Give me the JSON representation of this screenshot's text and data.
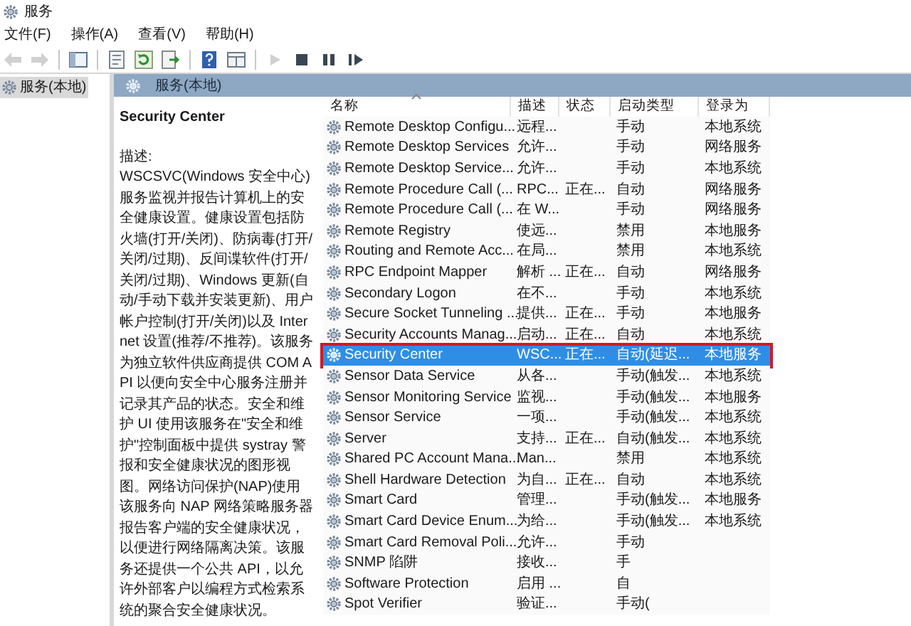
{
  "window": {
    "title": "服务"
  },
  "menu": [
    {
      "label": "文件(F)"
    },
    {
      "label": "操作(A)"
    },
    {
      "label": "查看(V)"
    },
    {
      "label": "帮助(H)"
    }
  ],
  "toolbar": [
    {
      "kind": "back",
      "disabled": true
    },
    {
      "kind": "forward",
      "disabled": true
    },
    {
      "kind": "sep"
    },
    {
      "kind": "tree",
      "disabled": false
    },
    {
      "kind": "sep"
    },
    {
      "kind": "properties",
      "disabled": false
    },
    {
      "kind": "refresh",
      "disabled": false
    },
    {
      "kind": "export",
      "disabled": false
    },
    {
      "kind": "sep"
    },
    {
      "kind": "help",
      "disabled": false
    },
    {
      "kind": "view",
      "disabled": false
    },
    {
      "kind": "sep"
    },
    {
      "kind": "play",
      "disabled": true
    },
    {
      "kind": "stop",
      "disabled": false
    },
    {
      "kind": "pause",
      "disabled": false
    },
    {
      "kind": "resume",
      "disabled": false
    }
  ],
  "tree": {
    "items": [
      {
        "label": "服务(本地)",
        "selected": true
      }
    ]
  },
  "pane_header": "服务(本地)",
  "details": {
    "title": "Security Center",
    "label": "描述:",
    "text": "WSCSVC(Windows 安全中心)服务监视并报告计算机上的安全健康设置。健康设置包括防火墙(打开/关闭)、防病毒(打开/关闭/过期)、反间谍软件(打开/关闭/过期)、Windows 更新(自动/手动下载并安装更新)、用户帐户控制(打开/关闭)以及 Internet 设置(推荐/不推荐)。该服务为独立软件供应商提供 COM API 以便向安全中心服务注册并记录其产品的状态。安全和维护 UI 使用该服务在\"安全和维护\"控制面板中提供 systray 警报和安全健康状况的图形视图。网络访问保护(NAP)使用该服务向 NAP 网络策略服务器报告客户端的安全健康状况，以便进行网络隔离决策。该服务还提供一个公共 API，以允许外部客户以编程方式检索系统的聚合安全健康状况。"
  },
  "table": {
    "columns": [
      "名称",
      "描述",
      "状态",
      "启动类型",
      "登录为"
    ],
    "rows": [
      {
        "name": "Remote Desktop Configu...",
        "desc": "远程...",
        "status": "",
        "startup": "手动",
        "logon": "本地系统",
        "selected": false
      },
      {
        "name": "Remote Desktop Services",
        "desc": "允许...",
        "status": "",
        "startup": "手动",
        "logon": "网络服务",
        "selected": false
      },
      {
        "name": "Remote Desktop Service...",
        "desc": "允许...",
        "status": "",
        "startup": "手动",
        "logon": "本地系统",
        "selected": false
      },
      {
        "name": "Remote Procedure Call (...",
        "desc": "RPC...",
        "status": "正在...",
        "startup": "自动",
        "logon": "网络服务",
        "selected": false
      },
      {
        "name": "Remote Procedure Call (...",
        "desc": "在 W...",
        "status": "",
        "startup": "手动",
        "logon": "网络服务",
        "selected": false
      },
      {
        "name": "Remote Registry",
        "desc": "使远...",
        "status": "",
        "startup": "禁用",
        "logon": "本地服务",
        "selected": false
      },
      {
        "name": "Routing and Remote Acc...",
        "desc": "在局...",
        "status": "",
        "startup": "禁用",
        "logon": "本地系统",
        "selected": false
      },
      {
        "name": "RPC Endpoint Mapper",
        "desc": "解析 ...",
        "status": "正在...",
        "startup": "自动",
        "logon": "网络服务",
        "selected": false
      },
      {
        "name": "Secondary Logon",
        "desc": "在不...",
        "status": "",
        "startup": "手动",
        "logon": "本地系统",
        "selected": false
      },
      {
        "name": "Secure Socket Tunneling ...",
        "desc": "提供...",
        "status": "正在...",
        "startup": "手动",
        "logon": "本地服务",
        "selected": false
      },
      {
        "name": "Security Accounts Manag...",
        "desc": "启动...",
        "status": "正在...",
        "startup": "自动",
        "logon": "本地系统",
        "selected": false
      },
      {
        "name": "Security Center",
        "desc": "WSC...",
        "status": "正在...",
        "startup": "自动(延迟...",
        "logon": "本地服务",
        "selected": true
      },
      {
        "name": "Sensor Data Service",
        "desc": "从各...",
        "status": "",
        "startup": "手动(触发...",
        "logon": "本地系统",
        "selected": false
      },
      {
        "name": "Sensor Monitoring Service",
        "desc": "监视...",
        "status": "",
        "startup": "手动(触发...",
        "logon": "本地服务",
        "selected": false
      },
      {
        "name": "Sensor Service",
        "desc": "一项...",
        "status": "",
        "startup": "手动(触发...",
        "logon": "本地系统",
        "selected": false
      },
      {
        "name": "Server",
        "desc": "支持...",
        "status": "正在...",
        "startup": "自动(触发...",
        "logon": "本地系统",
        "selected": false
      },
      {
        "name": "Shared PC Account Mana...",
        "desc": "Man...",
        "status": "",
        "startup": "禁用",
        "logon": "本地系统",
        "selected": false
      },
      {
        "name": "Shell Hardware Detection",
        "desc": "为自...",
        "status": "正在...",
        "startup": "自动",
        "logon": "本地系统",
        "selected": false
      },
      {
        "name": "Smart Card",
        "desc": "管理...",
        "status": "",
        "startup": "手动(触发...",
        "logon": "本地服务",
        "selected": false
      },
      {
        "name": "Smart Card Device Enum...",
        "desc": "为给...",
        "status": "",
        "startup": "手动(触发...",
        "logon": "本地系统",
        "selected": false
      },
      {
        "name": "Smart Card Removal Poli...",
        "desc": "允许...",
        "status": "",
        "startup": "手动",
        "logon": "",
        "selected": false
      },
      {
        "name": "SNMP 陷阱",
        "desc": "接收...",
        "status": "",
        "startup": "手",
        "logon": "",
        "selected": false
      },
      {
        "name": "Software Protection",
        "desc": "启用 ...",
        "status": "",
        "startup": "自",
        "logon": "",
        "selected": false
      },
      {
        "name": "Spot Verifier",
        "desc": "验证...",
        "status": "",
        "startup": "手动(",
        "logon": "",
        "selected": false
      }
    ]
  }
}
